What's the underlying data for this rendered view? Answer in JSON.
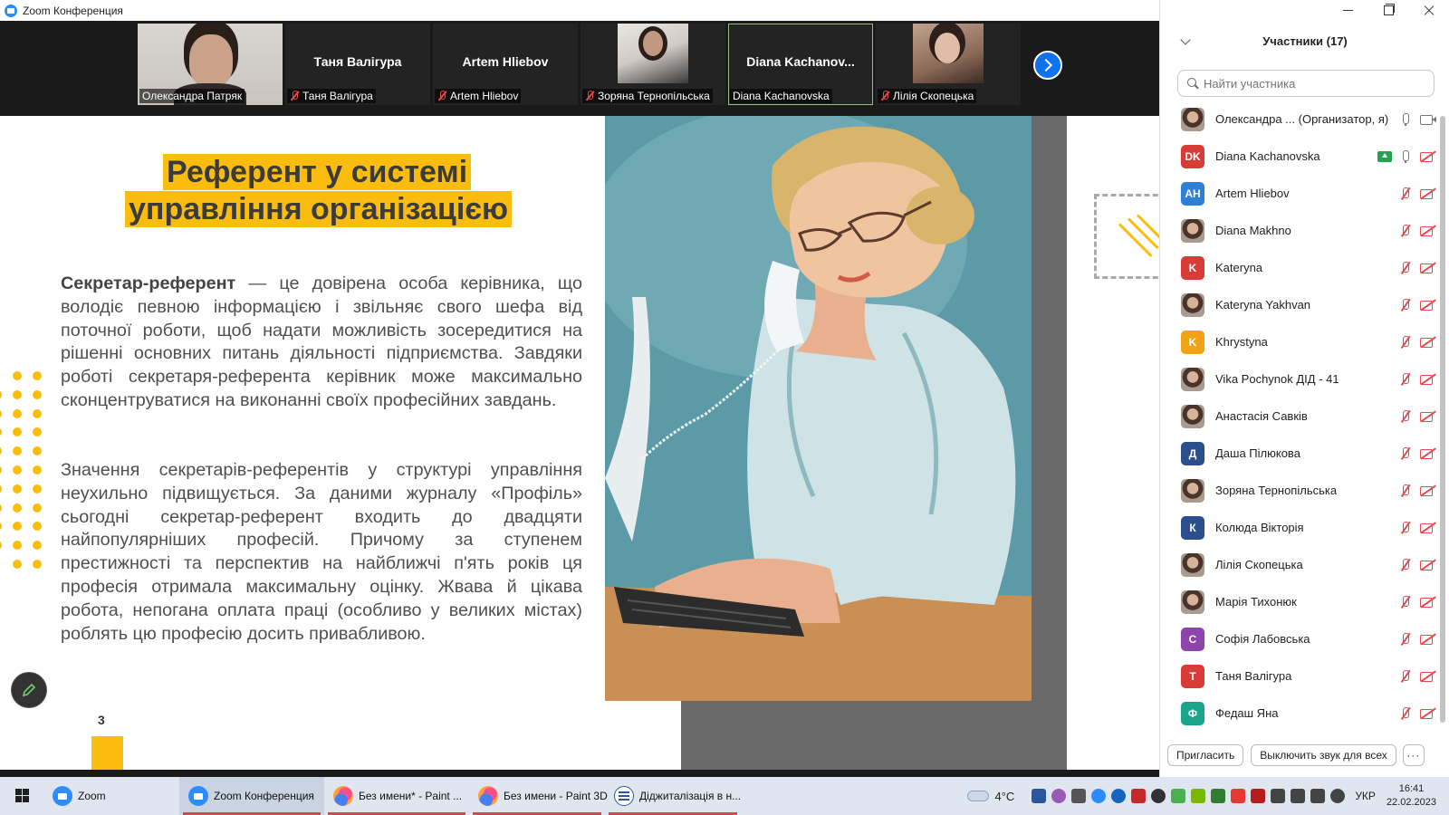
{
  "window": {
    "title": "Zoom Конференция"
  },
  "strip": {
    "tiles": [
      {
        "big": "",
        "caption": "Олександра Патряк",
        "muted": false
      },
      {
        "big": "Таня Валігура",
        "caption": "Таня Валігура",
        "muted": true
      },
      {
        "big": "Artem Hliebov",
        "caption": "Artem Hliebov",
        "muted": true
      },
      {
        "big": "",
        "caption": "Зоряна Тернопільська",
        "muted": true
      },
      {
        "big": "Diana  Kachanov...",
        "caption": "Diana Kachanovska",
        "muted": false
      },
      {
        "big": "",
        "caption": "Лілія Скопецька",
        "muted": true
      }
    ]
  },
  "slide": {
    "title_line1": "Референт у системі",
    "title_line2": "управління організацією",
    "p1_bold": "Секретар-референт",
    "p1_rest": " — це довірена особа керівника, що володіє певною інформацією і звільняє свого шефа від поточної роботи, щоб надати можливість зосередитися на рішенні основних питань діяльності підприємства. Завдяки роботі секретаря-референта керівник може максимально сконцентруватися на виконанні своїх професійних завдань.",
    "p2": "Значення секретарів-референтів у структурі управління неухильно підвищується. За даними журналу «Профіль» сьогодні секретар-референт входить до двадцяти найпопулярніших професій. Причому за ступенем престижності та перспектив на найближчі п'ять років ця професія отримала максимальну оцінку. Жвава й цікава робота, непогана оплата праці (особливо у великих містах) роблять цю професію досить привабливою.",
    "page_number": "3"
  },
  "panel": {
    "title": "Участники (17)",
    "search_placeholder": "Найти участника",
    "participants": [
      {
        "name": "Олександра ... (Организатор, я)",
        "initials": "",
        "color": "",
        "photo": true,
        "mic": "on",
        "cam": "on",
        "share": false
      },
      {
        "name": "Diana Kachanovska",
        "initials": "DK",
        "color": "#d73c36",
        "photo": false,
        "mic": "on",
        "cam": "off",
        "share": true
      },
      {
        "name": "Artem Hliebov",
        "initials": "AH",
        "color": "#2f7fd6",
        "photo": false,
        "mic": "off",
        "cam": "off",
        "share": false
      },
      {
        "name": "Diana Makhno",
        "initials": "",
        "color": "",
        "photo": true,
        "mic": "off",
        "cam": "off",
        "share": false
      },
      {
        "name": "Kateryna",
        "initials": "K",
        "color": "#d73c36",
        "photo": false,
        "mic": "off",
        "cam": "off",
        "share": false
      },
      {
        "name": "Kateryna Yakhvan",
        "initials": "",
        "color": "",
        "photo": true,
        "mic": "off",
        "cam": "off",
        "share": false
      },
      {
        "name": "Khrystyna",
        "initials": "K",
        "color": "#f0a313",
        "photo": false,
        "mic": "off",
        "cam": "off",
        "share": false
      },
      {
        "name": "Vika Pochynok ДІД - 41",
        "initials": "",
        "color": "",
        "photo": true,
        "mic": "off",
        "cam": "off",
        "share": false
      },
      {
        "name": "Анастасія Савків",
        "initials": "",
        "color": "",
        "photo": true,
        "mic": "off",
        "cam": "off",
        "share": false
      },
      {
        "name": "Даша Пілюкова",
        "initials": "Д",
        "color": "#2a4f8c",
        "photo": false,
        "mic": "off",
        "cam": "off",
        "share": false
      },
      {
        "name": "Зоряна Тернопільська",
        "initials": "",
        "color": "",
        "photo": true,
        "mic": "off",
        "cam": "off",
        "share": false
      },
      {
        "name": "Колюда Вікторія",
        "initials": "К",
        "color": "#2a4f8c",
        "photo": false,
        "mic": "off",
        "cam": "off",
        "share": false
      },
      {
        "name": "Лілія Скопецька",
        "initials": "",
        "color": "",
        "photo": true,
        "mic": "off",
        "cam": "off",
        "share": false
      },
      {
        "name": "Марія Тихонюк",
        "initials": "",
        "color": "",
        "photo": true,
        "mic": "off",
        "cam": "off",
        "share": false
      },
      {
        "name": "Софія Лабовська",
        "initials": "С",
        "color": "#8e44ad",
        "photo": false,
        "mic": "off",
        "cam": "off",
        "share": false
      },
      {
        "name": "Таня Валігура",
        "initials": "Т",
        "color": "#d73c36",
        "photo": false,
        "mic": "off",
        "cam": "off",
        "share": false
      },
      {
        "name": "Федаш Яна",
        "initials": "Ф",
        "color": "#1aa58a",
        "photo": false,
        "mic": "off",
        "cam": "off",
        "share": false
      }
    ],
    "invite_label": "Пригласить",
    "mute_all_label": "Выключить звук для всех",
    "more_label": "···"
  },
  "taskbar": {
    "apps": [
      {
        "label": "Zoom",
        "icon": "zoom-icon",
        "active": false
      },
      {
        "label": "Zoom Конференция",
        "icon": "zoom-icon",
        "active": true
      },
      {
        "label": "Без имени* - Paint ...",
        "icon": "paint3d-icon",
        "active": false
      },
      {
        "label": "Без имени - Paint 3D",
        "icon": "paint3d-icon",
        "active": false
      },
      {
        "label": "Діджиталізація в н...",
        "icon": "word-icon",
        "active": false
      }
    ],
    "temperature": "4°C",
    "language": "УКР",
    "time": "16:41",
    "date": "22.02.2023"
  },
  "colors": {
    "accent_yellow": "#fbbd0d",
    "zoom_blue": "#2d8cff",
    "mute_red": "#e5484d"
  }
}
